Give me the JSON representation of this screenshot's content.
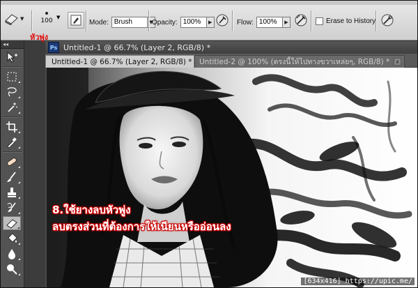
{
  "options_bar": {
    "brush_size": "100",
    "brush_caption_th": "หัวพู่ง",
    "mode_label": "Mode:",
    "mode_value": "Brush",
    "opacity_label": "Opacity:",
    "opacity_value": "100%",
    "flow_label": "Flow:",
    "flow_value": "100%",
    "erase_history_label": "Erase to History"
  },
  "document": {
    "window_title": "Untitled-1 @ 66.7% (Layer 2, RGB/8) *",
    "tabs": [
      {
        "label": "Untitled-1 @ 66.7% (Layer 2, RGB/8) *",
        "active": true
      },
      {
        "label": "Untitled-2 @ 100% (ตรงนี้ให้ไปทางขวาเหล่ยๆ, RGB/8) *",
        "active": false
      }
    ],
    "tab_close_glyph": "x"
  },
  "canvas": {
    "caption_line1": "8.ใช้ยางลบหัวพู่ง",
    "caption_line2": "ลบตรงส่วนที่ต้องการให้เนียนหรืออ่อนลง"
  },
  "watermark": "[634x416] https://upic.me/",
  "tools": [
    "move-tool",
    "marquee-tool",
    "lasso-tool",
    "quick-selection-tool",
    "crop-tool",
    "eyedropper-tool",
    "healing-brush-tool",
    "brush-tool",
    "clone-stamp-tool",
    "history-brush-tool",
    "eraser-tool",
    "paint-bucket-tool",
    "blur-tool",
    "dodge-tool"
  ],
  "colors": {
    "caption_outline": "#cc0000",
    "accent_red": "#e01010"
  }
}
